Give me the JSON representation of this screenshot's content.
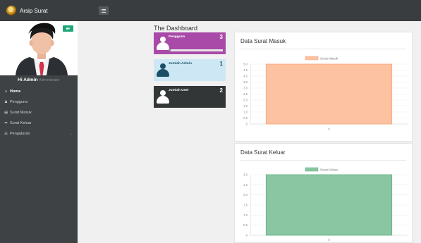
{
  "header": {
    "brand": "Arsip Surat",
    "logo_icon": "archive-logo-icon",
    "menu_icon": "hamburger-icon"
  },
  "sidebar": {
    "user_name": "Hi Admin",
    "user_role": "Administrator",
    "profile_button_icon": "user-caret-icon",
    "items": [
      {
        "label": "Home",
        "icon": "home-icon",
        "active": true
      },
      {
        "label": "Pengguna",
        "icon": "user-icon",
        "active": false
      },
      {
        "label": "Surat Masuk",
        "icon": "inbox-icon",
        "active": false
      },
      {
        "label": "Surat Keluar",
        "icon": "share-icon",
        "active": false
      },
      {
        "label": "Pengaturan",
        "icon": "settings-list-icon",
        "active": false,
        "has_caret": true
      }
    ]
  },
  "dashboard": {
    "title": "The Dashboard",
    "cards": [
      {
        "label": "Pengguna",
        "count": "3",
        "color": "#a94aa9"
      },
      {
        "label": "Jumlah Admin",
        "count": "1",
        "color": "#cde8f4"
      },
      {
        "label": "Jumlah User",
        "count": "2",
        "color": "#333637"
      }
    ]
  },
  "charts": {
    "masuk_title": "Data Surat Masuk",
    "keluar_title": "Data Surat Keluar"
  },
  "chart_data": [
    {
      "type": "bar",
      "title": "Data Surat Masuk",
      "categories": [
        "0"
      ],
      "series": [
        {
          "name": "Surat Masuk",
          "values": [
            5
          ],
          "color": "#fcc2a2",
          "border": "#f5a57a"
        }
      ],
      "yticks": [
        "0",
        "0.5",
        "1.0",
        "1.5",
        "2.0",
        "2.5",
        "3.0",
        "3.5",
        "4.0",
        "4.5",
        "5.0"
      ],
      "ylim": [
        0,
        5
      ],
      "legend": "top-center",
      "grid": true
    },
    {
      "type": "bar",
      "title": "Data Surat Keluar",
      "categories": [
        "0"
      ],
      "series": [
        {
          "name": "Surat Keluar",
          "values": [
            3
          ],
          "color": "#8ac6a2",
          "border": "#5fae83"
        }
      ],
      "yticks": [
        "0",
        "0.5",
        "1.0",
        "1.5",
        "2.0",
        "2.5",
        "3.0"
      ],
      "ylim": [
        0,
        3
      ],
      "legend": "top-center",
      "grid": true
    }
  ]
}
